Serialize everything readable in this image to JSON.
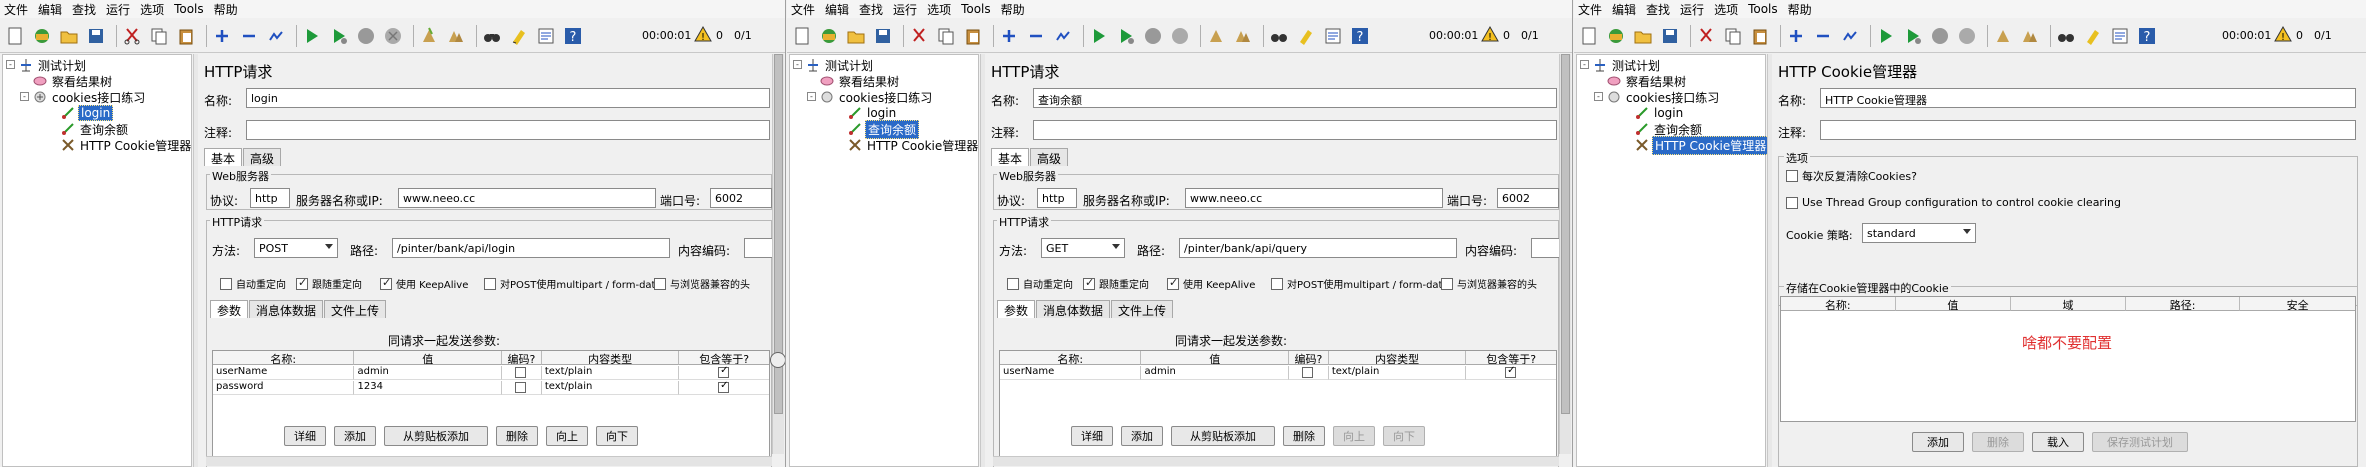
{
  "menu": [
    "文件",
    "编辑",
    "查找",
    "运行",
    "选项",
    "Tools",
    "帮助"
  ],
  "toolbar": {
    "timer": "00:00:01",
    "warn_count": "0",
    "threads": "0/1"
  },
  "tree": {
    "root": "测试计划",
    "results": "察看结果树",
    "group": "cookies接口练习",
    "login": "login",
    "query": "查询余额",
    "cookie_mgr": "HTTP Cookie管理器"
  },
  "http_common": {
    "title": "HTTP请求",
    "name_label": "名称:",
    "comment_label": "注释:",
    "tab_basic": "基本",
    "tab_adv": "高级",
    "web_server": "Web服务器",
    "protocol_label": "协议:",
    "protocol": "http",
    "server_label": "服务器名称或IP:",
    "server": "www.neeo.cc",
    "port_label": "端口号:",
    "port": "6002",
    "http_req": "HTTP请求",
    "method_label": "方法:",
    "path_label": "路径:",
    "encoding_label": "内容编码:",
    "cb_redirect": "自动重定向",
    "cb_follow": "跟随重定向",
    "cb_keepalive": "使用 KeepAlive",
    "cb_multipart": "对POST使用multipart / form-data",
    "cb_browser": "与浏览器兼容的头",
    "tab_params": "参数",
    "tab_body": "消息体数据",
    "tab_files": "文件上传",
    "send_with": "同请求一起发送参数:",
    "col_name": "名称:",
    "col_value": "值",
    "col_encode": "编码?",
    "col_type": "内容类型",
    "col_include": "包含等于?",
    "btn_detail": "详细",
    "btn_add": "添加",
    "btn_paste": "从剪贴板添加",
    "btn_delete": "删除",
    "btn_up": "向上",
    "btn_down": "向下"
  },
  "panel1": {
    "name": "login",
    "method": "POST",
    "path": "/pinter/bank/api/login",
    "rows": [
      {
        "name": "userName",
        "value": "admin",
        "encode": false,
        "type": "text/plain",
        "include": true
      },
      {
        "name": "password",
        "value": "1234",
        "encode": false,
        "type": "text/plain",
        "include": true
      }
    ]
  },
  "panel2": {
    "name": "查询余额",
    "method": "GET",
    "path": "/pinter/bank/api/query",
    "rows": [
      {
        "name": "userName",
        "value": "admin",
        "encode": false,
        "type": "text/plain",
        "include": true
      }
    ]
  },
  "panel3": {
    "title": "HTTP Cookie管理器",
    "name_label": "名称:",
    "name": "HTTP Cookie管理器",
    "comment_label": "注释:",
    "options": "选项",
    "cb_clear": "每次反复清除Cookies?",
    "cb_threadgroup": "Use Thread Group configuration to control cookie clearing",
    "policy_label": "Cookie 策略:",
    "policy": "standard",
    "stored": "存储在Cookie管理器中的Cookie",
    "col_name": "名称:",
    "col_value": "值",
    "col_domain": "域",
    "col_path": "路径:",
    "col_secure": "安全",
    "note": "啥都不要配置",
    "btn_add": "添加",
    "btn_delete": "删除",
    "btn_load": "载入",
    "btn_save": "保存测试计划"
  }
}
